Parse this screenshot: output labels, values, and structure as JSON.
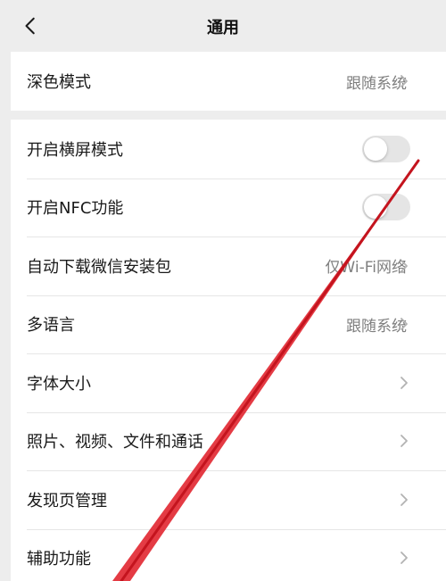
{
  "nav": {
    "title": "通用",
    "back_icon": "chevron-left-icon"
  },
  "dark_mode": {
    "label": "深色模式",
    "value": "跟随系统"
  },
  "items": [
    {
      "label": "开启横屏模式",
      "type": "toggle",
      "on": false
    },
    {
      "label": "开启NFC功能",
      "type": "toggle",
      "on": false
    },
    {
      "label": "自动下载微信安装包",
      "type": "link",
      "value": "仅Wi-Fi网络"
    },
    {
      "label": "多语言",
      "type": "link",
      "value": "跟随系统"
    },
    {
      "label": "字体大小",
      "type": "link"
    },
    {
      "label": "照片、视频、文件和通话",
      "type": "link"
    },
    {
      "label": "发现页管理",
      "type": "link"
    },
    {
      "label": "辅助功能",
      "type": "link"
    }
  ],
  "colors": {
    "background": "#ededed",
    "card": "#ffffff",
    "secondary_text": "#7f7f7f",
    "toggle_off": "#e5e5e5",
    "annotation_line": "#e0202a"
  }
}
